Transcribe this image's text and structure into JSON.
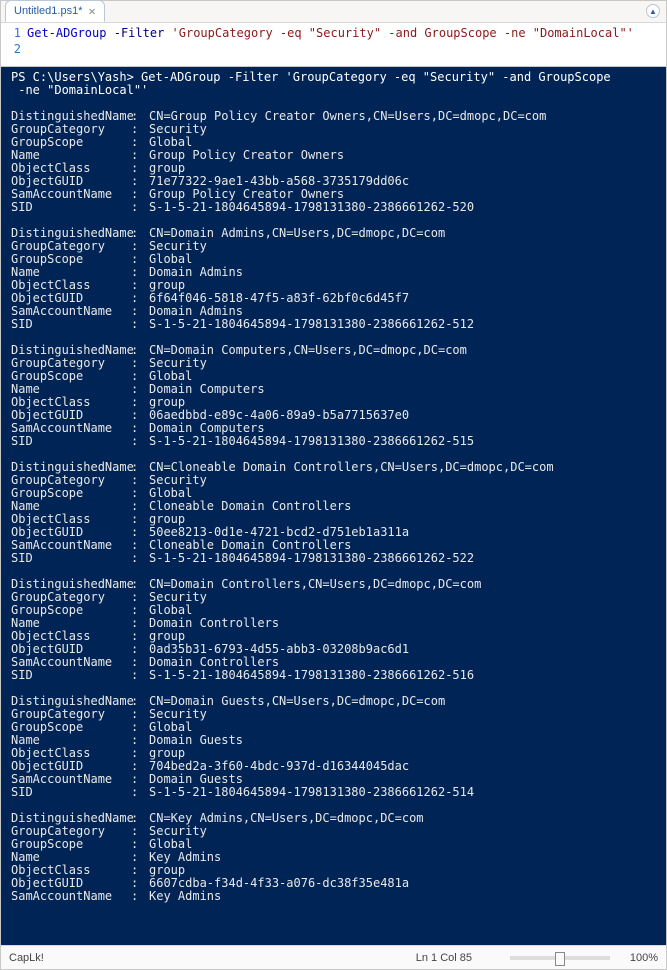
{
  "tab": {
    "title": "Untitled1.ps1*",
    "close": "✕"
  },
  "corner_btn_glyph": "▲",
  "editor": {
    "lines": [
      "1",
      "2"
    ],
    "cmd": "Get-ADGroup",
    "param": "-Filter",
    "str": "'GroupCategory -eq \"Security\" -and GroupScope -ne \"DomainLocal\"'"
  },
  "console": {
    "prompt_lines": [
      "PS C:\\Users\\Yash> Get-ADGroup -Filter 'GroupCategory -eq \"Security\" -and GroupScope",
      " -ne \"DomainLocal\"'"
    ],
    "field_labels": {
      "DistinguishedName": "DistinguishedName",
      "GroupCategory": "GroupCategory",
      "GroupScope": "GroupScope",
      "Name": "Name",
      "ObjectClass": "ObjectClass",
      "ObjectGUID": "ObjectGUID",
      "SamAccountName": "SamAccountName",
      "SID": "SID"
    },
    "groups": [
      {
        "DistinguishedName": "CN=Group Policy Creator Owners,CN=Users,DC=dmopc,DC=com",
        "GroupCategory": "Security",
        "GroupScope": "Global",
        "Name": "Group Policy Creator Owners",
        "ObjectClass": "group",
        "ObjectGUID": "71e77322-9ae1-43bb-a568-3735179dd06c",
        "SamAccountName": "Group Policy Creator Owners",
        "SID": "S-1-5-21-1804645894-1798131380-2386661262-520"
      },
      {
        "DistinguishedName": "CN=Domain Admins,CN=Users,DC=dmopc,DC=com",
        "GroupCategory": "Security",
        "GroupScope": "Global",
        "Name": "Domain Admins",
        "ObjectClass": "group",
        "ObjectGUID": "6f64f046-5818-47f5-a83f-62bf0c6d45f7",
        "SamAccountName": "Domain Admins",
        "SID": "S-1-5-21-1804645894-1798131380-2386661262-512"
      },
      {
        "DistinguishedName": "CN=Domain Computers,CN=Users,DC=dmopc,DC=com",
        "GroupCategory": "Security",
        "GroupScope": "Global",
        "Name": "Domain Computers",
        "ObjectClass": "group",
        "ObjectGUID": "06aedbbd-e89c-4a06-89a9-b5a7715637e0",
        "SamAccountName": "Domain Computers",
        "SID": "S-1-5-21-1804645894-1798131380-2386661262-515"
      },
      {
        "DistinguishedName": "CN=Cloneable Domain Controllers,CN=Users,DC=dmopc,DC=com",
        "GroupCategory": "Security",
        "GroupScope": "Global",
        "Name": "Cloneable Domain Controllers",
        "ObjectClass": "group",
        "ObjectGUID": "50ee8213-0d1e-4721-bcd2-d751eb1a311a",
        "SamAccountName": "Cloneable Domain Controllers",
        "SID": "S-1-5-21-1804645894-1798131380-2386661262-522"
      },
      {
        "DistinguishedName": "CN=Domain Controllers,CN=Users,DC=dmopc,DC=com",
        "GroupCategory": "Security",
        "GroupScope": "Global",
        "Name": "Domain Controllers",
        "ObjectClass": "group",
        "ObjectGUID": "0ad35b31-6793-4d55-abb3-03208b9ac6d1",
        "SamAccountName": "Domain Controllers",
        "SID": "S-1-5-21-1804645894-1798131380-2386661262-516"
      },
      {
        "DistinguishedName": "CN=Domain Guests,CN=Users,DC=dmopc,DC=com",
        "GroupCategory": "Security",
        "GroupScope": "Global",
        "Name": "Domain Guests",
        "ObjectClass": "group",
        "ObjectGUID": "704bed2a-3f60-4bdc-937d-d16344045dac",
        "SamAccountName": "Domain Guests",
        "SID": "S-1-5-21-1804645894-1798131380-2386661262-514"
      },
      {
        "DistinguishedName": "CN=Key Admins,CN=Users,DC=dmopc,DC=com",
        "GroupCategory": "Security",
        "GroupScope": "Global",
        "Name": "Key Admins",
        "ObjectClass": "group",
        "ObjectGUID": "6607cdba-f34d-4f33-a076-dc38f35e481a",
        "SamAccountName": "Key Admins"
      }
    ]
  },
  "statusbar": {
    "caps": "CapLk!",
    "pos": "Ln 1  Col 85",
    "zoom": "100%"
  }
}
